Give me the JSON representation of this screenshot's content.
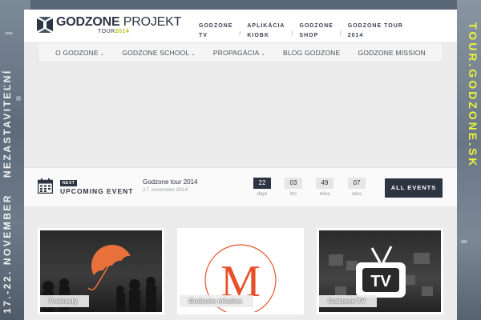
{
  "side_banners": {
    "left_date": "17.-22. NOVEMBER",
    "left_text": "NEZASTAVITEĽNÍ",
    "right_text": "TOUR.GODZONE.SK"
  },
  "logo": {
    "bold": "GODZONE",
    "light": "PROJEKT",
    "sub_prefix": "TOUR",
    "sub_year": "2014"
  },
  "topnav": [
    {
      "label": "GODZONE\nTV"
    },
    {
      "label": "APLIKÁCIA\nKIOBK"
    },
    {
      "label": "GODZONE\nSHOP"
    },
    {
      "label": "GODZONE TOUR\n2014"
    }
  ],
  "mainnav": [
    {
      "label": "O GODZONE",
      "dropdown": true
    },
    {
      "label": "GODZONE SCHOOL",
      "dropdown": true
    },
    {
      "label": "PROPAGÁCIA",
      "dropdown": true
    },
    {
      "label": "BLOG GODZONE",
      "dropdown": false
    },
    {
      "label": "GODZONE MISSION",
      "dropdown": false
    }
  ],
  "event": {
    "badge": "NEXT",
    "label": "UPCOMING EVENT",
    "title": "Godzone tour 2014",
    "date": "17. november 2014",
    "countdown": [
      {
        "value": "22",
        "unit": "days"
      },
      {
        "value": "03",
        "unit": "hrs"
      },
      {
        "value": "49",
        "unit": "mins"
      },
      {
        "value": "07",
        "unit": "secs"
      }
    ],
    "button": "ALL EVENTS"
  },
  "tiles": [
    {
      "label": "Podcasty"
    },
    {
      "label": "Godzone mission"
    },
    {
      "label": "Godzone TV"
    }
  ],
  "colors": {
    "navy": "#2d3442",
    "accent_yellow": "#e8f53a",
    "umbrella": "#e8703a",
    "mission_orange": "#e8502a"
  }
}
